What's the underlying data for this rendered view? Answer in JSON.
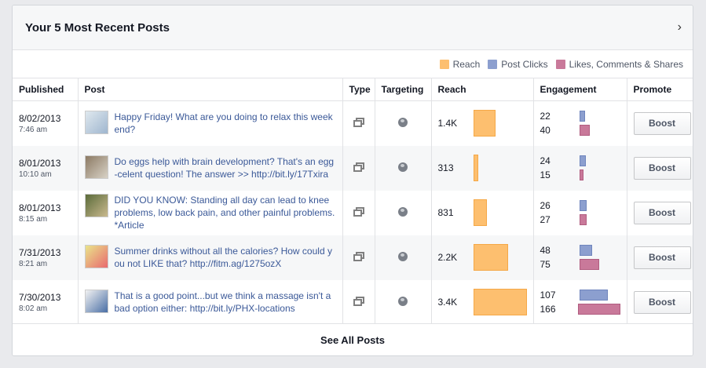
{
  "header": {
    "title": "Your 5 Most Recent Posts"
  },
  "legend": [
    {
      "label": "Reach",
      "color": "#fdbf6f"
    },
    {
      "label": "Post Clicks",
      "color": "#8c9fcf"
    },
    {
      "label": "Likes, Comments & Shares",
      "color": "#c9799a"
    }
  ],
  "columns": {
    "published": "Published",
    "post": "Post",
    "type": "Type",
    "targeting": "Targeting",
    "reach": "Reach",
    "engagement": "Engagement",
    "promote": "Promote"
  },
  "posts": [
    {
      "date": "8/02/2013",
      "time": "7:46 am",
      "text": "Happy Friday! What are you doing to relax this weekend?",
      "reach": "1.4K",
      "reach_value": 1400,
      "clicks": "22",
      "clicks_value": 22,
      "likes": "40",
      "likes_value": 40,
      "boost_label": "Boost",
      "thumb_colors": [
        "#dfe8ee",
        "#9fb6cf"
      ]
    },
    {
      "date": "8/01/2013",
      "time": "10:10 am",
      "text": "Do eggs help with brain development? That's an egg-celent question! The answer >> http://bit.ly/17Txira",
      "reach": "313",
      "reach_value": 313,
      "clicks": "24",
      "clicks_value": 24,
      "likes": "15",
      "likes_value": 15,
      "boost_label": "Boost",
      "thumb_colors": [
        "#8c7a64",
        "#d8d2c6"
      ]
    },
    {
      "date": "8/01/2013",
      "time": "8:15 am",
      "text": "DID YOU KNOW: Standing all day can lead to knee problems, low back pain, and other painful problems. *Article",
      "reach": "831",
      "reach_value": 831,
      "clicks": "26",
      "clicks_value": 26,
      "likes": "27",
      "likes_value": 27,
      "boost_label": "Boost",
      "thumb_colors": [
        "#5b6b3a",
        "#c9b98e"
      ]
    },
    {
      "date": "7/31/2013",
      "time": "8:21 am",
      "text": "Summer drinks without all the calories? How could you not LIKE that? http://fitm.ag/1275ozX",
      "reach": "2.2K",
      "reach_value": 2200,
      "clicks": "48",
      "clicks_value": 48,
      "likes": "75",
      "likes_value": 75,
      "boost_label": "Boost",
      "thumb_colors": [
        "#e9e48a",
        "#e96a6f"
      ]
    },
    {
      "date": "7/30/2013",
      "time": "8:02 am",
      "text": "That is a good point...but we think a massage isn't a bad option either: http://bit.ly/PHX-locations",
      "reach": "3.4K",
      "reach_value": 3400,
      "clicks": "107",
      "clicks_value": 107,
      "likes": "166",
      "likes_value": 166,
      "boost_label": "Boost",
      "thumb_colors": [
        "#f2f2f2",
        "#4a6fa5"
      ]
    }
  ],
  "footer": {
    "see_all": "See All Posts"
  }
}
